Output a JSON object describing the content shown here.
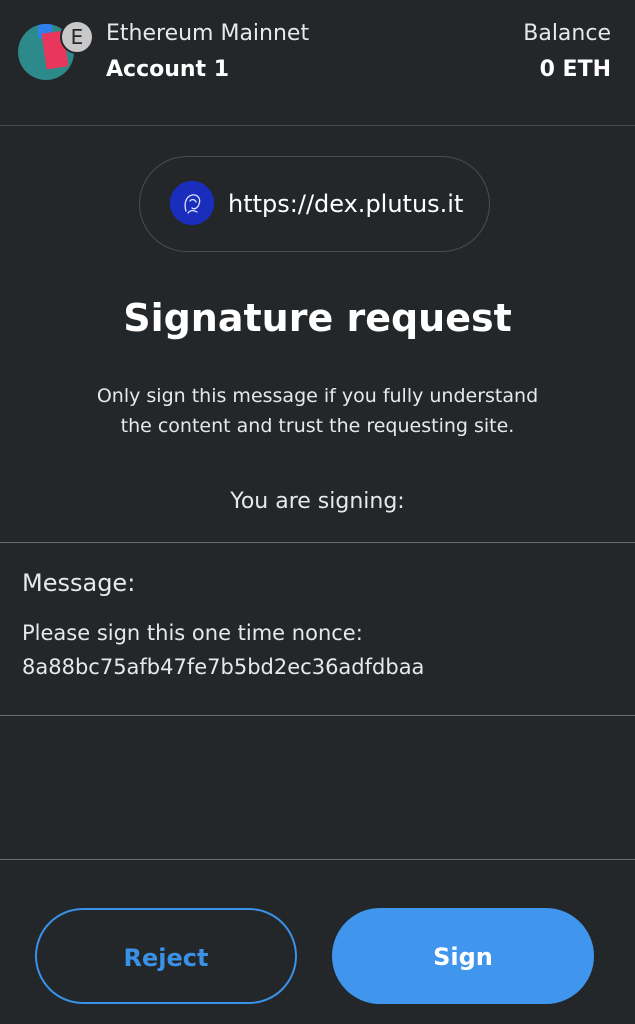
{
  "header": {
    "network_badge": "E",
    "network_name": "Ethereum Mainnet",
    "account_name": "Account 1",
    "balance_label": "Balance",
    "balance_value": "0 ETH"
  },
  "origin": {
    "url": "https://dex.plutus.it",
    "icon": "site-favicon"
  },
  "request": {
    "title": "Signature request",
    "warning_line1": "Only sign this message if you fully understand",
    "warning_line2": "the content and trust the requesting site.",
    "signing_label": "You are signing:"
  },
  "message": {
    "label": "Message:",
    "line1": "Please sign this one time nonce:",
    "line2": "8a88bc75afb47fe7b5bd2ec36adfdbaa"
  },
  "actions": {
    "reject_label": "Reject",
    "sign_label": "Sign"
  },
  "colors": {
    "background": "#24272a",
    "accent": "#4096ec",
    "site_icon": "#1a2dbd"
  }
}
